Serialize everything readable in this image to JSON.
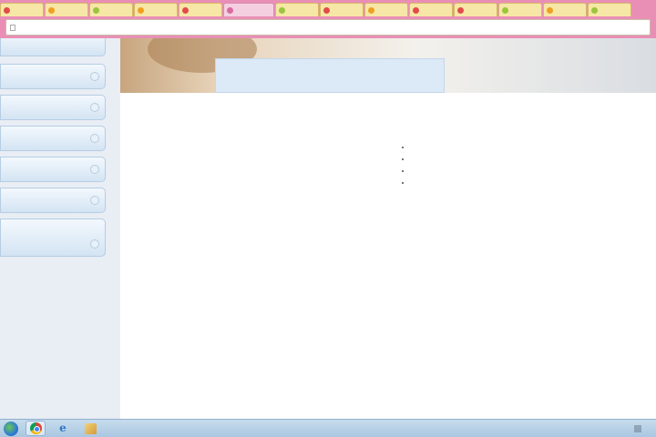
{
  "browser": {
    "tabs": [
      {
        "label": "",
        "color": "#e34b4b"
      },
      {
        "label": "",
        "color": "#f0a020"
      },
      {
        "label": "",
        "color": "#9bc53d"
      },
      {
        "label": "",
        "color": "#f0a020"
      },
      {
        "label": "",
        "color": "#e34b4b"
      },
      {
        "label": "",
        "color": "#d86aa0",
        "active": true
      },
      {
        "label": "",
        "color": "#9bc53d"
      },
      {
        "label": "",
        "color": "#e34b4b"
      },
      {
        "label": "",
        "color": "#f0a020"
      },
      {
        "label": "",
        "color": "#e34b4b"
      },
      {
        "label": "",
        "color": "#e34b4b"
      },
      {
        "label": "",
        "color": "#9bc53d"
      },
      {
        "label": "",
        "color": "#f0a020"
      },
      {
        "label": "",
        "color": "#9bc53d"
      }
    ],
    "address": "",
    "accent_color": "#e98fb6"
  },
  "sidebar": {
    "items": [
      {
        "label": ""
      },
      {
        "label": ""
      },
      {
        "label": ""
      },
      {
        "label": ""
      },
      {
        "label": ""
      },
      {
        "label": ""
      }
    ]
  },
  "main": {
    "banner_title": "",
    "left_paragraphs": [
      "",
      "",
      ""
    ],
    "right": {
      "heading": "",
      "prep_time_label": "",
      "prep_time_value": "",
      "ingredients_label": "",
      "ingredients": [
        "",
        "",
        "",
        ""
      ],
      "method_label": "",
      "steps": [
        {
          "num": "",
          "text": ""
        },
        {
          "num": "",
          "text": ""
        },
        {
          "num": "",
          "text": ""
        },
        {
          "num": "",
          "text": ""
        }
      ]
    }
  },
  "taskbar": {
    "apps": [
      "chrome-icon",
      "ie-icon",
      "paint-icon"
    ],
    "clock": ""
  }
}
